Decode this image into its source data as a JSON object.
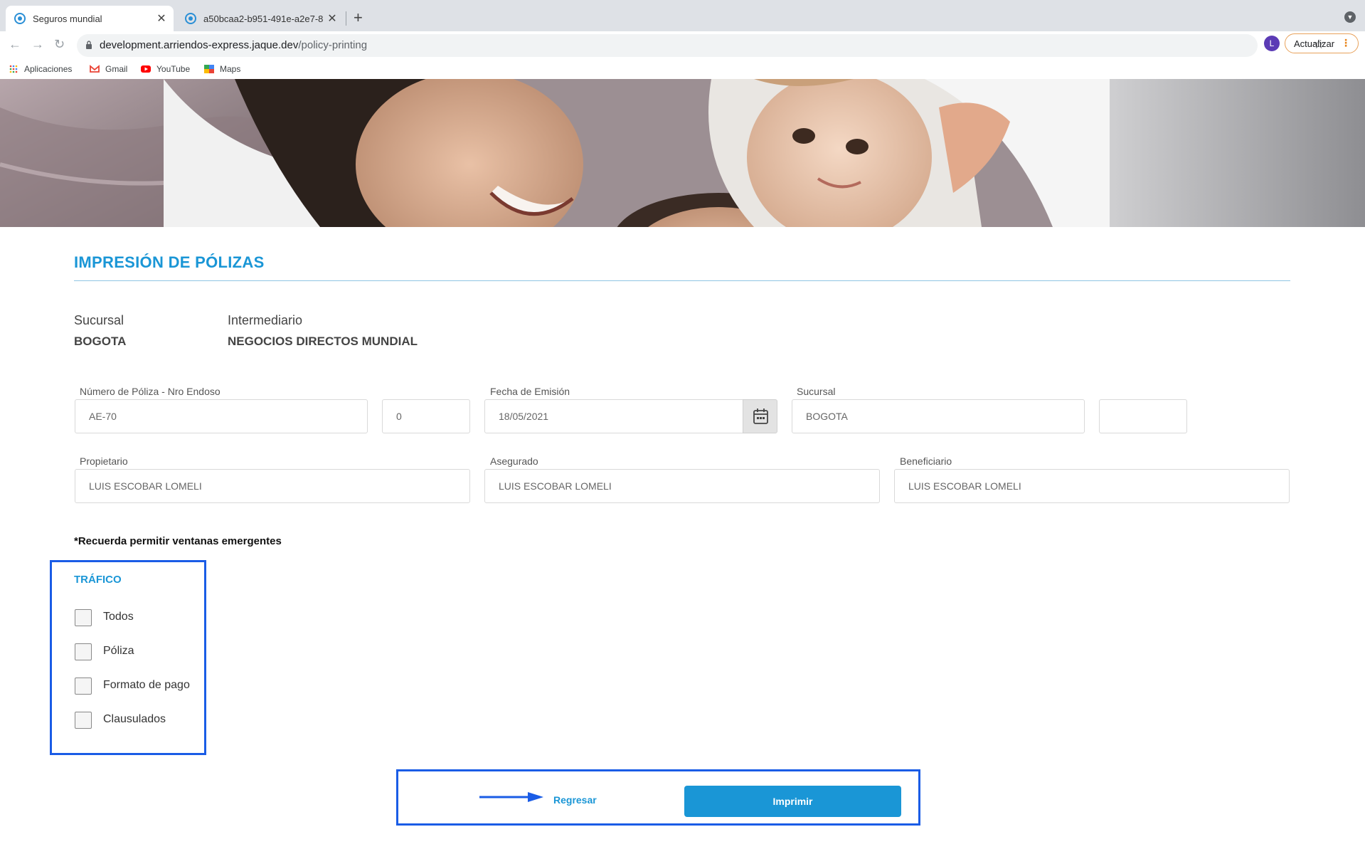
{
  "browser": {
    "tabs": [
      {
        "label": "Seguros mundial",
        "active": true
      },
      {
        "label": "a50bcaa2-b951-491e-a2e7-8",
        "active": false
      }
    ],
    "url_host": "development.arriendos-express.jaque.dev",
    "url_path": "/policy-printing",
    "avatar_letter": "L",
    "update_label": "Actualizar",
    "bookmarks": [
      "Aplicaciones",
      "Gmail",
      "YouTube",
      "Maps"
    ]
  },
  "page": {
    "title": "IMPRESIÓN DE PÓLIZAS",
    "sucursal_label": "Sucursal",
    "sucursal_value": "BOGOTA",
    "intermediario_label": "Intermediario",
    "intermediario_value": "NEGOCIOS DIRECTOS MUNDIAL"
  },
  "form": {
    "policy_label": "Número de Póliza - Nro Endoso",
    "policy_value": "AE-70",
    "endorsement_value": "0",
    "issue_date_label": "Fecha de Emisión",
    "issue_date_value": "18/05/2021",
    "branch_label": "Sucursal",
    "branch_value": "BOGOTA",
    "branch_extra_value": "",
    "owner_label": "Propietario",
    "owner_value": "LUIS ESCOBAR LOMELI",
    "insured_label": "Asegurado",
    "insured_value": "LUIS ESCOBAR LOMELI",
    "beneficiary_label": "Beneficiario",
    "beneficiary_value": "LUIS ESCOBAR LOMELI"
  },
  "popup_note": "*Recuerda permitir ventanas emergentes",
  "traffic": {
    "title": "TRÁFICO",
    "options": [
      "Todos",
      "Póliza",
      "Formato de pago",
      "Clausulados"
    ]
  },
  "actions": {
    "back_label": "Regresar",
    "print_label": "Imprimir"
  },
  "colors": {
    "accent": "#1a96d6",
    "highlight_box": "#1a5ce6"
  }
}
